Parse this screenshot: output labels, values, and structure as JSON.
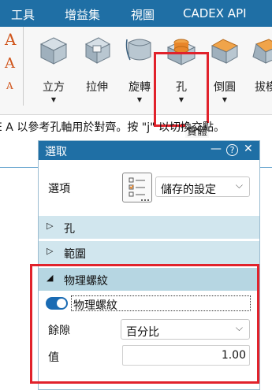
{
  "menu": {
    "items": [
      "工具",
      "增益集",
      "視圖",
      "CADEX API"
    ]
  },
  "ribbon": {
    "tools": [
      {
        "label": "立方",
        "icon": "cube-icon"
      },
      {
        "label": "拉伸",
        "icon": "extrude-icon"
      },
      {
        "label": "旋轉",
        "icon": "revolve-icon"
      },
      {
        "label": "孔",
        "icon": "hole-icon"
      },
      {
        "label": "倒圓",
        "icon": "fillet-icon"
      },
      {
        "label": "拔模",
        "icon": "draft-icon"
      }
    ],
    "group_label": "實體"
  },
  "hint": "E A 以參考孔軸用於對齊。按 \"j\" 以切換交點。",
  "panel": {
    "title": "選取",
    "controls": {
      "minimize": "—",
      "help": "?",
      "close": "✕"
    },
    "options_label": "選項",
    "options_value": "儲存的設定",
    "sections": {
      "hole": "孔",
      "extent": "範圍",
      "thread": "物理螺紋"
    },
    "thread": {
      "toggle_label": "物理螺紋",
      "toggle_on": true,
      "clearance_label": "餘隙",
      "clearance_value": "百分比",
      "value_label": "值",
      "value": "1.00"
    }
  },
  "colors": {
    "accent": "#1f6fa5",
    "highlight": "#e1222b",
    "section_bg": "#d1e6ee"
  }
}
